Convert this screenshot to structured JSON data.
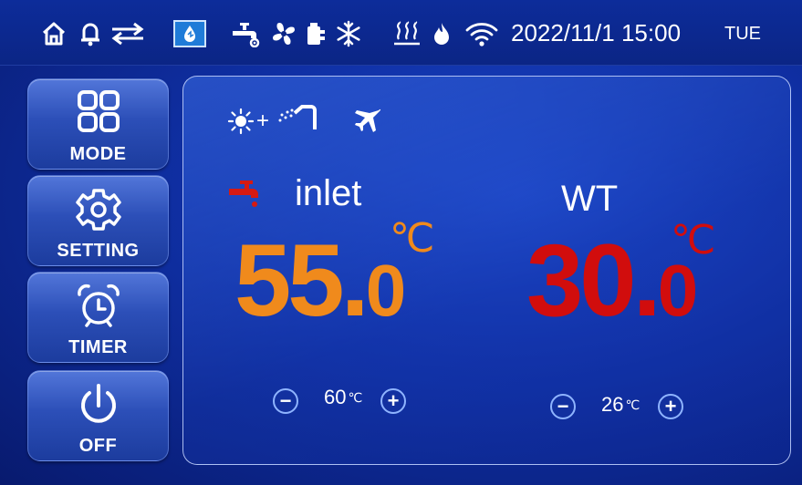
{
  "status_bar": {
    "date_time": "2022/11/1 15:00",
    "weekday": "TUE",
    "icons": [
      "home-icon",
      "bell-icon",
      "swap-arrows-icon",
      "water-drop-icon",
      "faucet-gear-icon",
      "fan-icon",
      "compressor-icon",
      "snowflake-icon",
      "heating-icon",
      "flame-icon",
      "wifi-icon"
    ]
  },
  "menu": {
    "mode_label": "MODE",
    "setting_label": "SETTING",
    "timer_label": "TIMER",
    "off_label": "OFF"
  },
  "panel": {
    "mode_icons": [
      "sun-icon",
      "plus-icon",
      "shower-icon",
      "airplane-icon"
    ],
    "left": {
      "label": "inlet",
      "temp_int": "55",
      "temp_dec": "0",
      "unit": "℃",
      "set_value": "60",
      "set_unit": "℃",
      "color": "#f08a1c"
    },
    "right": {
      "label": "WT",
      "temp_int": "30",
      "temp_dec": "0",
      "unit": "℃",
      "set_value": "26",
      "set_unit": "℃",
      "color": "#d10d0d"
    },
    "minus": "−",
    "plus": "+",
    "dot": "."
  }
}
